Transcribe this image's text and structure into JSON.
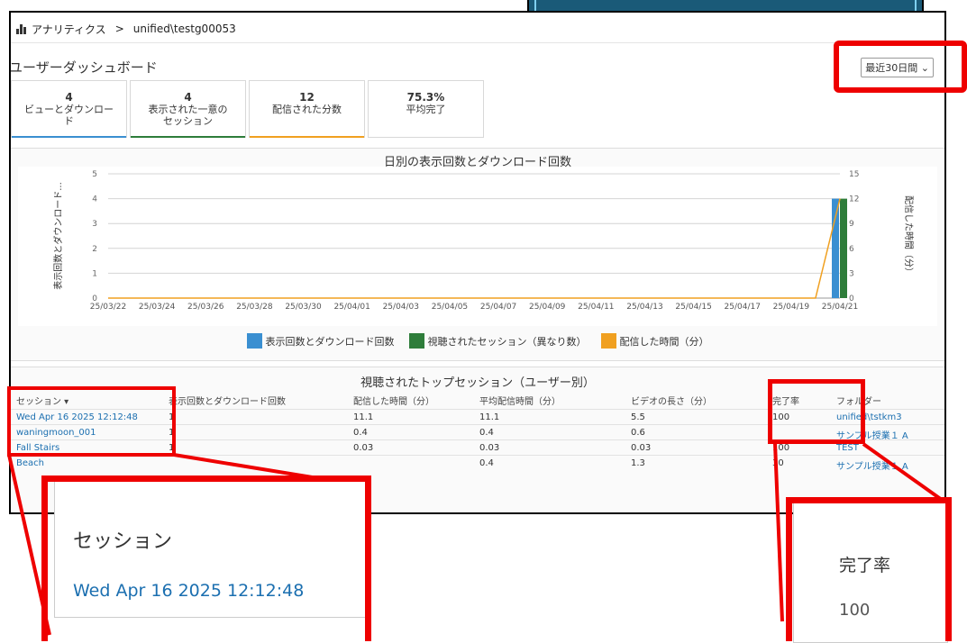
{
  "breadcrumb": {
    "app": "アナリティクス",
    "separator": ">",
    "path": "unified\\testg00053"
  },
  "page": {
    "title": "ユーザーダッシュボード",
    "range_label": "最近30日間"
  },
  "tiles": [
    {
      "value": "4",
      "label_line1": "ビューとダウンロー",
      "label_line2": "ド",
      "color": "#3a8fd1"
    },
    {
      "value": "4",
      "label_line1": "表示された一意の",
      "label_line2": "セッション",
      "color": "#2e7d3a"
    },
    {
      "value": "12",
      "label_line1": "配信された分数",
      "label_line2": "",
      "color": "#f0a020"
    },
    {
      "value": "75.3%",
      "label_line1": "平均完了",
      "label_line2": "",
      "color": "#cccccc"
    }
  ],
  "chart_data": {
    "type": "bar",
    "title": "日別の表示回数とダウンロード回数",
    "ylabel": "表示回数とダウンロード...",
    "y2label": "配信した時間（分）",
    "ylim": [
      0,
      5
    ],
    "y2lim": [
      0,
      15
    ],
    "yticks": [
      "0",
      "1",
      "2",
      "3",
      "4",
      "5"
    ],
    "y2ticks": [
      "0",
      "3",
      "6",
      "9",
      "12",
      "15"
    ],
    "x_tick_labels": [
      "25/03/22",
      "25/03/24",
      "25/03/26",
      "25/03/28",
      "25/03/30",
      "25/04/01",
      "25/04/03",
      "25/04/05",
      "25/04/07",
      "25/04/09",
      "25/04/11",
      "25/04/13",
      "25/04/15",
      "25/04/17",
      "25/04/19",
      "25/04/21"
    ],
    "categories": [
      "25/03/22",
      "25/03/23",
      "25/03/24",
      "25/03/25",
      "25/03/26",
      "25/03/27",
      "25/03/28",
      "25/03/29",
      "25/03/30",
      "25/03/31",
      "25/04/01",
      "25/04/02",
      "25/04/03",
      "25/04/04",
      "25/04/05",
      "25/04/06",
      "25/04/07",
      "25/04/08",
      "25/04/09",
      "25/04/10",
      "25/04/11",
      "25/04/12",
      "25/04/13",
      "25/04/14",
      "25/04/15",
      "25/04/16",
      "25/04/17",
      "25/04/18",
      "25/04/19",
      "25/04/20",
      "25/04/21"
    ],
    "series": [
      {
        "name": "表示回数とダウンロード回数",
        "kind": "bar",
        "color": "#3a8fd1",
        "values": [
          0,
          0,
          0,
          0,
          0,
          0,
          0,
          0,
          0,
          0,
          0,
          0,
          0,
          0,
          0,
          0,
          0,
          0,
          0,
          0,
          0,
          0,
          0,
          0,
          0,
          0,
          0,
          0,
          0,
          0,
          4
        ]
      },
      {
        "name": "視聴されたセッション（異なり数）",
        "kind": "bar",
        "color": "#2e7d3a",
        "values": [
          0,
          0,
          0,
          0,
          0,
          0,
          0,
          0,
          0,
          0,
          0,
          0,
          0,
          0,
          0,
          0,
          0,
          0,
          0,
          0,
          0,
          0,
          0,
          0,
          0,
          0,
          0,
          0,
          0,
          0,
          4
        ]
      },
      {
        "name": "配信した時間（分）",
        "kind": "line",
        "axis": "right",
        "color": "#f0a020",
        "values": [
          0,
          0,
          0,
          0,
          0,
          0,
          0,
          0,
          0,
          0,
          0,
          0,
          0,
          0,
          0,
          0,
          0,
          0,
          0,
          0,
          0,
          0,
          0,
          0,
          0,
          0,
          0,
          0,
          0,
          0,
          12
        ]
      }
    ],
    "grid": true,
    "legend": "bottom"
  },
  "table": {
    "title": "視聴されたトップセッション（ユーザー別）",
    "headers": [
      "セッション ▾",
      "表示回数とダウンロード回数",
      "配信した時間（分）",
      "平均配信時間（分）",
      "ビデオの長さ（分）",
      "完了率",
      "フォルダー"
    ],
    "rows": [
      [
        "Wed Apr 16 2025 12:12:48",
        "1",
        "11.1",
        "11.1",
        "5.5",
        "100",
        "unified\\tstkm3"
      ],
      [
        "waningmoon_001",
        "1",
        "0.4",
        "0.4",
        "0.6",
        "",
        "サンプル授業１ A"
      ],
      [
        "Fall Stairs",
        "1",
        "0.03",
        "0.03",
        "0.03",
        "100",
        "TEST"
      ],
      [
        "Beach",
        "",
        "",
        "0.4",
        "1.3",
        "30",
        "サンプル授業１ A"
      ]
    ]
  },
  "zoom_left": {
    "header": "セッション",
    "value": "Wed Apr 16 2025 12:12:48"
  },
  "zoom_right": {
    "header": "完了率",
    "value": "100"
  },
  "colors": {
    "highlight_red": "#ee0000",
    "callout_fill": "#1a5a78",
    "link_blue": "#1b6fb0"
  }
}
